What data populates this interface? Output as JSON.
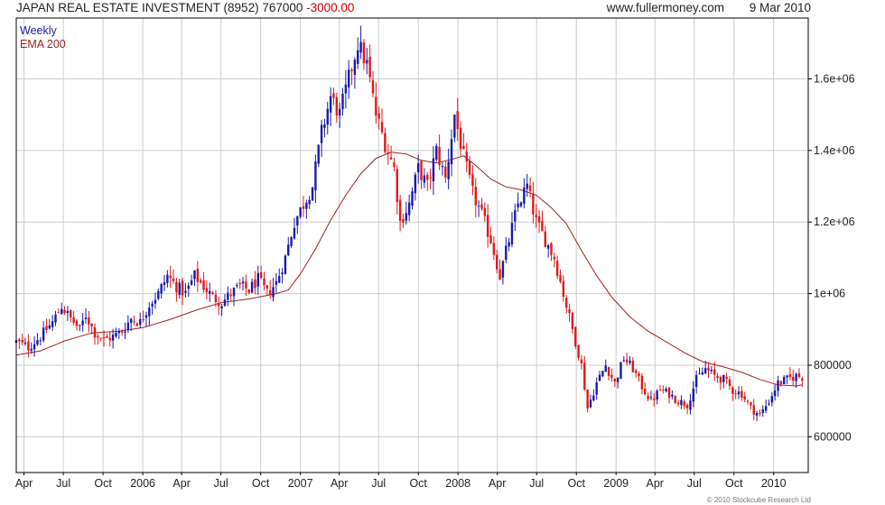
{
  "header": {
    "title": "JAPAN REAL ESTATE INVESTMENT (8952) 767000",
    "change": "-3000.00",
    "site": "www.fullermoney.com",
    "date": "9 Mar 2010"
  },
  "legend": {
    "items": [
      "Weekly",
      "EMA 200"
    ]
  },
  "copyright": "© 2010 Stockcube Research Ltd",
  "colors": {
    "up": "#1a1aaa",
    "down": "#e01818",
    "ema": "#a02020",
    "grid": "#cccccc",
    "frame": "#000000"
  },
  "chart_data": {
    "type": "candlestick",
    "frequency": "weekly",
    "y_ticks": [
      600000,
      800000,
      1000000,
      1200000,
      1400000,
      1600000
    ],
    "y_tick_labels": [
      "600000",
      "800000",
      "1e+06",
      "1.2e+06",
      "1.4e+06",
      "1.6e+06"
    ],
    "ylim": [
      500000,
      1770000
    ],
    "x_ticks": [
      "2005-04",
      "2005-07",
      "2005-10",
      "2006-01",
      "2006-04",
      "2006-07",
      "2006-10",
      "2007-01",
      "2007-04",
      "2007-07",
      "2007-10",
      "2008-01",
      "2008-04",
      "2008-07",
      "2008-10",
      "2009-01",
      "2009-04",
      "2009-07",
      "2009-10",
      "2010-01"
    ],
    "x_tick_labels": [
      "Apr",
      "Jul",
      "Oct",
      "2006",
      "Apr",
      "Jul",
      "Oct",
      "2007",
      "Apr",
      "Jul",
      "Oct",
      "2008",
      "Apr",
      "Jul",
      "Oct",
      "2009",
      "Apr",
      "Jul",
      "Oct",
      "2010"
    ],
    "xlim": [
      "2005-03-14",
      "2010-03-22"
    ],
    "series": [
      {
        "name": "Weekly",
        "kind": "close",
        "points": [
          [
            "2005-03-14",
            865000
          ],
          [
            "2005-04-11",
            850000
          ],
          [
            "2005-05-09",
            880000
          ],
          [
            "2005-06-06",
            920000
          ],
          [
            "2005-06-27",
            965000
          ],
          [
            "2005-07-18",
            930000
          ],
          [
            "2005-08-08",
            900000
          ],
          [
            "2005-08-22",
            940000
          ],
          [
            "2005-09-12",
            890000
          ],
          [
            "2005-10-03",
            870000
          ],
          [
            "2005-10-24",
            880000
          ],
          [
            "2005-11-14",
            895000
          ],
          [
            "2005-12-05",
            930000
          ],
          [
            "2005-12-26",
            920000
          ],
          [
            "2006-01-16",
            970000
          ],
          [
            "2006-02-06",
            1000000
          ],
          [
            "2006-02-27",
            1050000
          ],
          [
            "2006-03-20",
            1020000
          ],
          [
            "2006-04-10",
            1000000
          ],
          [
            "2006-05-01",
            1050000
          ],
          [
            "2006-05-22",
            1020000
          ],
          [
            "2006-06-12",
            990000
          ],
          [
            "2006-07-03",
            975000
          ],
          [
            "2006-07-24",
            1000000
          ],
          [
            "2006-08-14",
            1020000
          ],
          [
            "2006-09-04",
            1010000
          ],
          [
            "2006-09-25",
            1040000
          ],
          [
            "2006-10-16",
            1000000
          ],
          [
            "2006-11-06",
            1030000
          ],
          [
            "2006-11-27",
            1100000
          ],
          [
            "2006-12-18",
            1200000
          ],
          [
            "2007-01-08",
            1250000
          ],
          [
            "2007-01-29",
            1300000
          ],
          [
            "2007-02-19",
            1450000
          ],
          [
            "2007-03-12",
            1550000
          ],
          [
            "2007-04-02",
            1500000
          ],
          [
            "2007-04-23",
            1600000
          ],
          [
            "2007-05-14",
            1700000
          ],
          [
            "2007-06-04",
            1640000
          ],
          [
            "2007-06-25",
            1500000
          ],
          [
            "2007-07-16",
            1420000
          ],
          [
            "2007-08-06",
            1350000
          ],
          [
            "2007-08-20",
            1200000
          ],
          [
            "2007-09-10",
            1250000
          ],
          [
            "2007-10-01",
            1350000
          ],
          [
            "2007-10-22",
            1300000
          ],
          [
            "2007-11-12",
            1400000
          ],
          [
            "2007-12-03",
            1320000
          ],
          [
            "2007-12-24",
            1500000
          ],
          [
            "2008-01-14",
            1380000
          ],
          [
            "2008-02-04",
            1280000
          ],
          [
            "2008-02-25",
            1220000
          ],
          [
            "2008-03-17",
            1150000
          ],
          [
            "2008-04-07",
            1050000
          ],
          [
            "2008-04-28",
            1150000
          ],
          [
            "2008-05-19",
            1250000
          ],
          [
            "2008-06-09",
            1300000
          ],
          [
            "2008-06-30",
            1200000
          ],
          [
            "2008-07-21",
            1150000
          ],
          [
            "2008-08-11",
            1100000
          ],
          [
            "2008-09-01",
            1000000
          ],
          [
            "2008-09-22",
            900000
          ],
          [
            "2008-10-13",
            800000
          ],
          [
            "2008-10-27",
            680000
          ],
          [
            "2008-11-17",
            750000
          ],
          [
            "2008-12-08",
            800000
          ],
          [
            "2008-12-29",
            750000
          ],
          [
            "2009-01-19",
            820000
          ],
          [
            "2009-02-09",
            790000
          ],
          [
            "2009-03-02",
            740000
          ],
          [
            "2009-03-23",
            700000
          ],
          [
            "2009-04-13",
            730000
          ],
          [
            "2009-05-04",
            720000
          ],
          [
            "2009-05-25",
            700000
          ],
          [
            "2009-06-15",
            690000
          ],
          [
            "2009-07-06",
            760000
          ],
          [
            "2009-07-27",
            790000
          ],
          [
            "2009-08-17",
            770000
          ],
          [
            "2009-09-07",
            760000
          ],
          [
            "2009-09-28",
            730000
          ],
          [
            "2009-10-19",
            720000
          ],
          [
            "2009-11-09",
            680000
          ],
          [
            "2009-11-30",
            660000
          ],
          [
            "2009-12-21",
            700000
          ],
          [
            "2010-01-11",
            750000
          ],
          [
            "2010-02-01",
            760000
          ],
          [
            "2010-02-22",
            770000
          ],
          [
            "2010-03-08",
            767000
          ]
        ]
      },
      {
        "name": "EMA 200",
        "kind": "line",
        "points": [
          [
            "2005-03-14",
            828000
          ],
          [
            "2005-05-09",
            840000
          ],
          [
            "2005-07-04",
            868000
          ],
          [
            "2005-09-05",
            890000
          ],
          [
            "2005-11-07",
            895000
          ],
          [
            "2006-01-02",
            905000
          ],
          [
            "2006-03-06",
            928000
          ],
          [
            "2006-05-08",
            955000
          ],
          [
            "2006-07-03",
            975000
          ],
          [
            "2006-09-04",
            985000
          ],
          [
            "2006-11-06",
            1000000
          ],
          [
            "2006-12-04",
            1010000
          ],
          [
            "2007-01-01",
            1055000
          ],
          [
            "2007-02-05",
            1125000
          ],
          [
            "2007-03-12",
            1205000
          ],
          [
            "2007-04-16",
            1275000
          ],
          [
            "2007-05-21",
            1335000
          ],
          [
            "2007-06-25",
            1378000
          ],
          [
            "2007-07-30",
            1395000
          ],
          [
            "2007-09-03",
            1390000
          ],
          [
            "2007-10-08",
            1372000
          ],
          [
            "2007-11-12",
            1365000
          ],
          [
            "2007-12-17",
            1375000
          ],
          [
            "2008-01-14",
            1385000
          ],
          [
            "2008-02-11",
            1358000
          ],
          [
            "2008-03-17",
            1320000
          ],
          [
            "2008-04-21",
            1298000
          ],
          [
            "2008-05-26",
            1290000
          ],
          [
            "2008-06-30",
            1275000
          ],
          [
            "2008-08-04",
            1240000
          ],
          [
            "2008-09-08",
            1195000
          ],
          [
            "2008-10-13",
            1120000
          ],
          [
            "2008-11-17",
            1050000
          ],
          [
            "2008-12-22",
            990000
          ],
          [
            "2009-02-02",
            935000
          ],
          [
            "2009-03-16",
            895000
          ],
          [
            "2009-04-27",
            865000
          ],
          [
            "2009-06-08",
            835000
          ],
          [
            "2009-07-20",
            810000
          ],
          [
            "2009-09-07",
            795000
          ],
          [
            "2009-10-19",
            780000
          ],
          [
            "2009-11-30",
            760000
          ],
          [
            "2010-01-11",
            745000
          ],
          [
            "2010-02-22",
            742000
          ],
          [
            "2010-03-08",
            745000
          ]
        ]
      }
    ]
  }
}
